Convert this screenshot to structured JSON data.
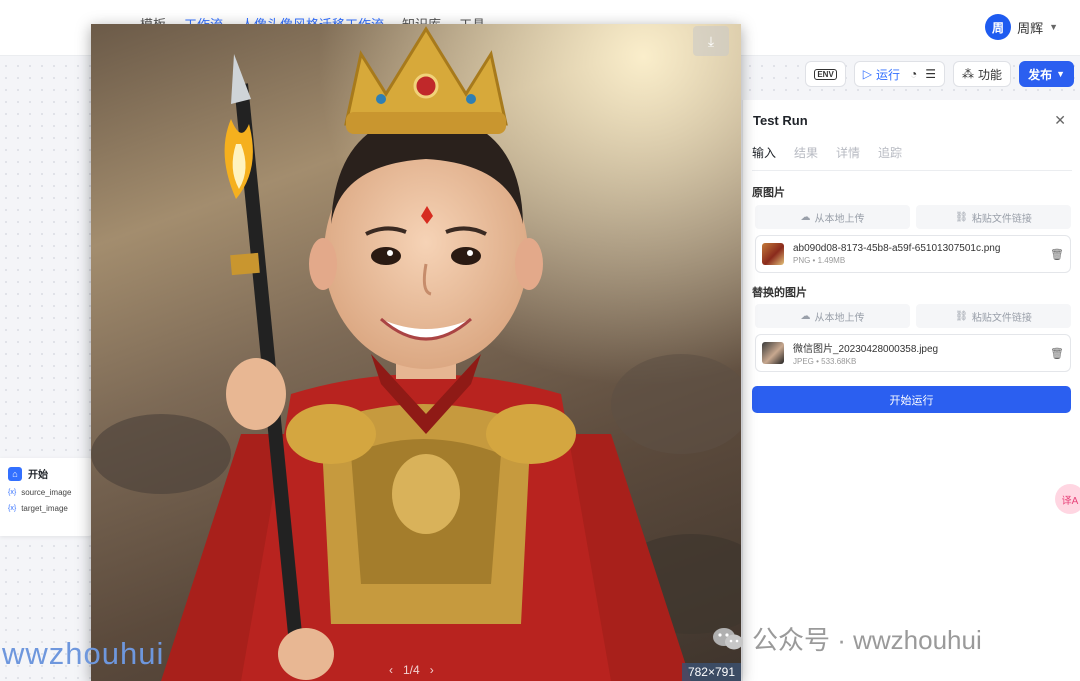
{
  "breadcrumbs": [
    "模板",
    "工作流",
    "人像头像风格迁移工作流",
    "知识库",
    "工具"
  ],
  "user": {
    "avatar_text": "周",
    "name": "周辉"
  },
  "toolbar": {
    "env_label": "ENV",
    "run_label": "运行",
    "feature_label": "功能",
    "publish_label": "发布"
  },
  "start_node": {
    "title": "开始",
    "vars": [
      {
        "tag": "{x}",
        "name": "source_image"
      },
      {
        "tag": "{x}",
        "name": "target_image"
      }
    ]
  },
  "panel": {
    "title": "Test Run",
    "tabs": [
      "输入",
      "结果",
      "详情",
      "追踪"
    ],
    "upload_local": "从本地上传",
    "paste_link": "粘贴文件链接",
    "source": {
      "label": "原图片",
      "file_name": "ab090d08-8173-45b8-a59f-65101307501c.png",
      "file_meta": "PNG • 1.49MB"
    },
    "target": {
      "label": "替换的图片",
      "file_name": "微信图片_20230428000358.jpeg",
      "file_meta": "JPEG • 533.68KB"
    },
    "run_button": "开始运行"
  },
  "preview": {
    "page": "1/4",
    "dims": "782×791"
  },
  "watermarks": {
    "left": "wwzhouhui",
    "right": "公众号 · wwzhouhui"
  },
  "colors": {
    "accent": "#2b5ff0",
    "robe": "#b8231f",
    "gold": "#d4a640"
  }
}
